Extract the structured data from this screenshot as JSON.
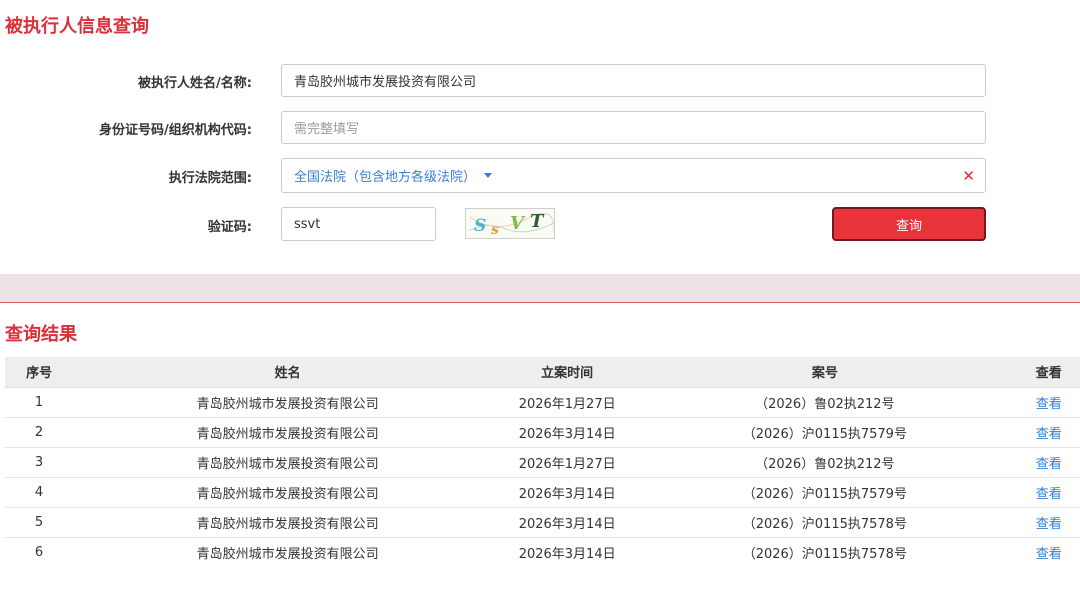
{
  "page": {
    "title": "被执行人信息查询"
  },
  "form": {
    "name_label": "被执行人姓名/名称:",
    "name_value": "青岛胶州城市发展投资有限公司",
    "id_label": "身份证号码/组织机构代码:",
    "id_placeholder": "需完整填写",
    "court_label": "执行法院范围:",
    "court_value": "全国法院（包含地方各级法院）",
    "captcha_label": "验证码:",
    "captcha_value": "ssvt",
    "captcha_image_text": "SsVT",
    "query_button": "查询"
  },
  "results": {
    "title": "查询结果",
    "columns": [
      "序号",
      "姓名",
      "立案时间",
      "案号",
      "查看"
    ],
    "rows": [
      {
        "no": "1",
        "name": "青岛胶州城市发展投资有限公司",
        "date": "2026年1月27日",
        "case": "（2026）鲁02执212号",
        "view": "查看"
      },
      {
        "no": "2",
        "name": "青岛胶州城市发展投资有限公司",
        "date": "2026年3月14日",
        "case": "（2026）沪0115执7579号",
        "view": "查看"
      },
      {
        "no": "3",
        "name": "青岛胶州城市发展投资有限公司",
        "date": "2026年1月27日",
        "case": "（2026）鲁02执212号",
        "view": "查看"
      },
      {
        "no": "4",
        "name": "青岛胶州城市发展投资有限公司",
        "date": "2026年3月14日",
        "case": "（2026）沪0115执7579号",
        "view": "查看"
      },
      {
        "no": "5",
        "name": "青岛胶州城市发展投资有限公司",
        "date": "2026年3月14日",
        "case": "（2026）沪0115执7578号",
        "view": "查看"
      },
      {
        "no": "6",
        "name": "青岛胶州城市发展投资有限公司",
        "date": "2026年3月14日",
        "case": "（2026）沪0115执7578号",
        "view": "查看"
      }
    ]
  },
  "colors": {
    "accent_red": "#d9303a",
    "button_red": "#e8333b",
    "link_blue": "#2f7fd6"
  },
  "icons": {
    "select_caret": "caret-down-icon",
    "clear": "clear-x-icon"
  }
}
